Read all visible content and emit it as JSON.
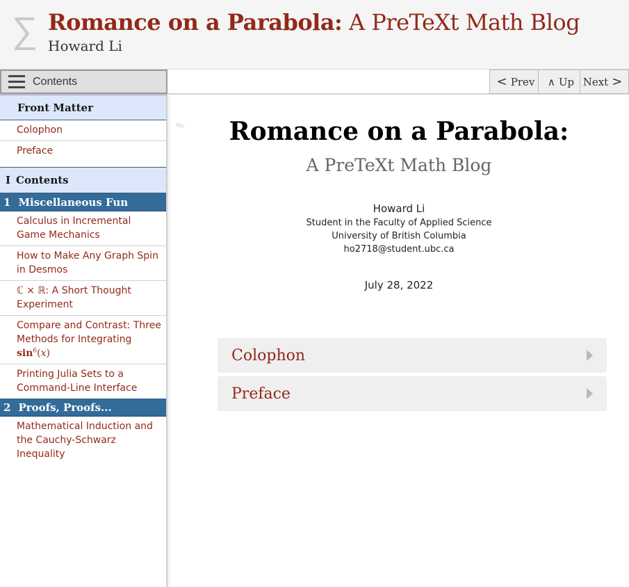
{
  "header": {
    "logo_symbol": "∑",
    "title_bold": "Romance on a Parabola:",
    "title_rest": "A PreTeXt Math Blog",
    "byline": "Howard Li"
  },
  "navbar": {
    "toc_label": "Contents",
    "prev_label": "Prev",
    "up_label": "Up",
    "next_label": "Next"
  },
  "sidebar": {
    "front_matter_heading": "Front Matter",
    "front_matter_items": [
      "Colophon",
      "Preface"
    ],
    "part": {
      "number": "I",
      "title": "Contents"
    },
    "chapter1": {
      "number": "1",
      "title": "Miscellaneous Fun"
    },
    "chapter1_items": [
      "Calculus in Incremental Game Mechanics",
      "How to Make Any Graph Spin in Desmos",
      "ℂ × ℝ: A Short Thought Experiment",
      "Compare and Contrast: Three Methods for Integrating",
      "Printing Julia Sets to a Command-Line Interface"
    ],
    "integrand": {
      "func": "sin",
      "power": "6",
      "var": "x"
    },
    "chapter2": {
      "number": "2",
      "title": "Proofs, Proofs..."
    },
    "chapter2_items": [
      "Mathematical Induction and the Cauchy-Schwarz Inequality"
    ]
  },
  "main": {
    "title": "Romance on a Parabola:",
    "subtitle": "A PreTeXt Math Blog",
    "author": "Howard Li",
    "affiliation": [
      "Student in the Faculty of Applied Science",
      "University of British Columbia",
      "ho2718@student.ubc.ca"
    ],
    "date": "July 28, 2022",
    "knowls": [
      "Colophon",
      "Preface"
    ]
  },
  "colors": {
    "brand_red": "#932919",
    "chapter_blue": "#336b99",
    "heading_bg": "#dde7fb"
  }
}
